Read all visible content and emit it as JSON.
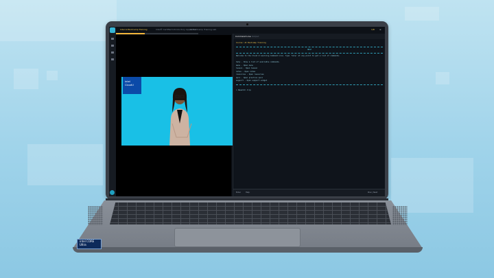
{
  "app": {
    "course_title": "Intel AI Bootcamp Training",
    "tab_2": "Intel® Certified Introductory Applied AI",
    "tab_3": "AI Bootcamp Training Lab",
    "counter": "1/8",
    "progress_pct": 35
  },
  "lesson": {
    "logo_line1": "intel",
    "logo_line2": "CloudU"
  },
  "panel": {
    "tab_active": "Command Line",
    "tab_other": "Output",
    "terminal": [
      {
        "text": "Course: AI Bootcamp Training",
        "color": "accent"
      },
      {
        "text": "HELP",
        "color": "center"
      },
      {
        "text": "Welcome to the Cloud U Learning Command Line. Type 'help' at any point to get a list of commands.",
        "color": "normal"
      },
      {
        "text": "",
        "color": "normal"
      },
      {
        "text": "help   - Show a list of available commands.",
        "color": "normal"
      },
      {
        "text": "menu   - Open menu",
        "color": "normal"
      },
      {
        "text": "lesson - Open lesson",
        "color": "normal"
      },
      {
        "text": "notes  - Open notes",
        "color": "normal"
      },
      {
        "text": "resources - Open resources",
        "color": "normal"
      },
      {
        "text": "quiz   - Open practice quiz",
        "color": "normal"
      },
      {
        "text": "support - Open support widget",
        "color": "normal"
      },
      {
        "text": "",
        "color": "normal"
      },
      {
        "text": "> Rewatch clip",
        "color": "normal"
      }
    ],
    "footer_left": "Enter",
    "footer_left2": "Help",
    "footer_right": "Prev  |  Next"
  },
  "sticker": "intel CORE Ultra"
}
